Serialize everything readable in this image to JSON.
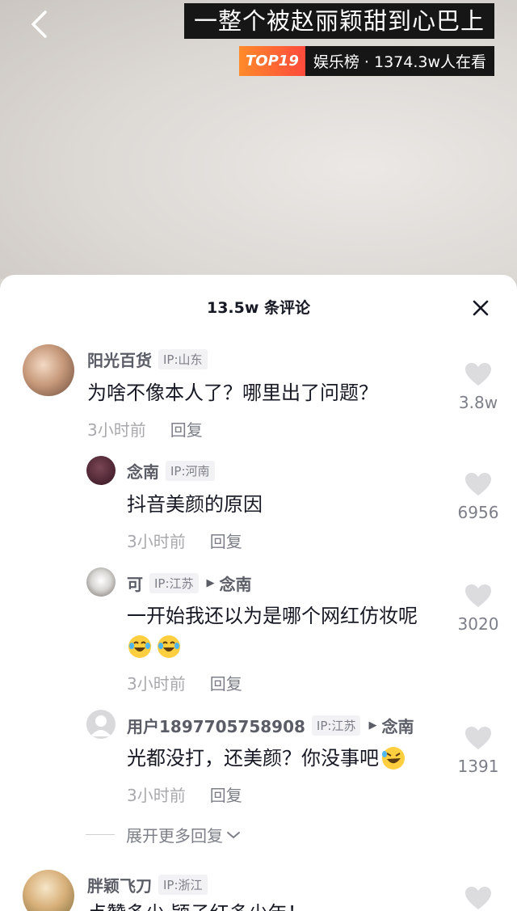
{
  "video": {
    "title": "一整个被赵丽颖甜到心巴上",
    "rank_badge": "TOP19",
    "rank_info": "娱乐榜 · 1374.3w人在看"
  },
  "comments_panel": {
    "title": "13.5w 条评论",
    "expand_label": "展开更多回复"
  },
  "comments": [
    {
      "user": "阳光百货",
      "ip": "IP:山东",
      "text": "为啥不像本人了？哪里出了问题？",
      "time": "3小时前",
      "reply": "回复",
      "likes": "3.8w"
    },
    {
      "user": "念南",
      "ip": "IP:河南",
      "text": "抖音美颜的原因",
      "time": "3小时前",
      "reply": "回复",
      "likes": "6956"
    },
    {
      "user": "可",
      "ip": "IP:江苏",
      "reply_to": "念南",
      "text": "一开始我还以为是哪个网红仿妆呢",
      "time": "3小时前",
      "reply": "回复",
      "likes": "3020"
    },
    {
      "user": "用户1897705758908",
      "ip": "IP:江苏",
      "reply_to": "念南",
      "text": "光都没打，还美颜？你没事吧",
      "time": "3小时前",
      "reply": "回复",
      "likes": "1391"
    },
    {
      "user": "胖颖飞刀",
      "ip": "IP:浙江",
      "text": "点赞多少 颖子红多少年！"
    }
  ]
}
